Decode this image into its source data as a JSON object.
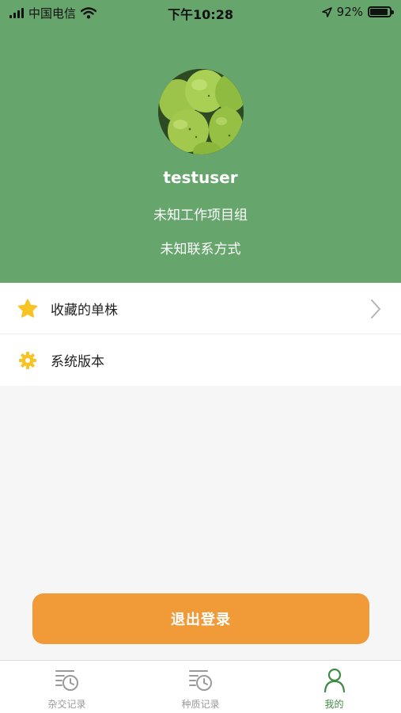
{
  "statusbar": {
    "carrier": "中国电信",
    "time": "下午10:28",
    "battery": "92%",
    "battery_level": 0.92
  },
  "profile": {
    "username": "testuser",
    "project": "未知工作项目组",
    "contact": "未知联系方式"
  },
  "menu": {
    "items": [
      {
        "label": "收藏的单株",
        "icon": "star-icon"
      },
      {
        "label": "系统版本",
        "icon": "gear-icon"
      }
    ]
  },
  "logout_label": "退出登录",
  "tabbar": {
    "tabs": [
      {
        "label": "杂交记录",
        "icon": "list-clock-icon",
        "active": false
      },
      {
        "label": "种质记录",
        "icon": "list-clock-icon",
        "active": false
      },
      {
        "label": "我的",
        "icon": "user-icon",
        "active": true
      }
    ]
  },
  "colors": {
    "header_green": "#66a56c",
    "logout_orange": "#f09a38",
    "active_tab": "#3f8a45",
    "star_yellow": "#f7c325"
  }
}
